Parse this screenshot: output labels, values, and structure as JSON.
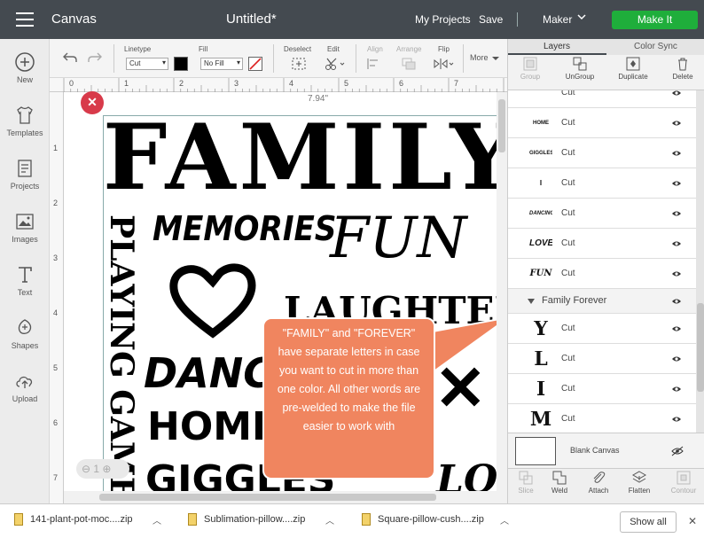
{
  "topbar": {
    "app_name": "Canvas",
    "doc_title": "Untitled*",
    "my_projects": "My Projects",
    "save": "Save",
    "machine": "Maker",
    "make_it": "Make It"
  },
  "leftnav": {
    "items": [
      "New",
      "Templates",
      "Projects",
      "Images",
      "Text",
      "Shapes",
      "Upload"
    ]
  },
  "toolbar": {
    "linetype_label": "Linetype",
    "linetype_value": "Cut",
    "fill_label": "Fill",
    "fill_value": "No Fill",
    "deselect_label": "Deselect",
    "edit_label": "Edit",
    "align_label": "Align",
    "arrange_label": "Arrange",
    "flip_label": "Flip",
    "more_label": "More"
  },
  "ruler": {
    "ticks": [
      "0",
      "1",
      "2",
      "3",
      "4",
      "5",
      "6",
      "7",
      "8"
    ]
  },
  "canvas": {
    "dimension": "7.94\"",
    "words": [
      "FAMILY",
      "MEMORIES",
      "FUN",
      "PLAYING GAMES",
      "LAUGHTER",
      "DANCING",
      "HOME",
      "GIGGLES",
      "LOVE"
    ]
  },
  "callout": {
    "text": "\"FAMILY\" and \"FOREVER\" have separate letters in case you want to cut in more than one color. All other words are pre-welded to make the file easier to work with"
  },
  "rightpanel": {
    "tabs": [
      "Layers",
      "Color Sync"
    ],
    "tools": [
      "Group",
      "UnGroup",
      "Duplicate",
      "Delete"
    ],
    "layers": [
      {
        "thumb": "",
        "label": "Cut"
      },
      {
        "thumb": "HOME SWEET",
        "label": "Cut"
      },
      {
        "thumb": "GIGGLES",
        "label": "Cut"
      },
      {
        "thumb": "I",
        "label": "Cut"
      },
      {
        "thumb": "DANCING",
        "label": "Cut"
      },
      {
        "thumb": "LOVE",
        "label": "Cut"
      },
      {
        "thumb": "FUN",
        "label": "Cut"
      }
    ],
    "group_label": "Family Forever",
    "group_layers": [
      {
        "thumb": "Y",
        "label": "Cut"
      },
      {
        "thumb": "L",
        "label": "Cut"
      },
      {
        "thumb": "I",
        "label": "Cut"
      },
      {
        "thumb": "M",
        "label": "Cut"
      }
    ],
    "blank_canvas": "Blank Canvas",
    "bottom_tools": [
      "Slice",
      "Weld",
      "Attach",
      "Flatten",
      "Contour"
    ]
  },
  "downloads": {
    "items": [
      "141-plant-pot-moc....zip",
      "Sublimation-pillow....zip",
      "Square-pillow-cush....zip"
    ],
    "show_all": "Show all"
  },
  "colors": {
    "topbar": "#444a50",
    "make_it": "#1fae3b",
    "callout": "#f0855f",
    "delete": "#d83a4a"
  }
}
